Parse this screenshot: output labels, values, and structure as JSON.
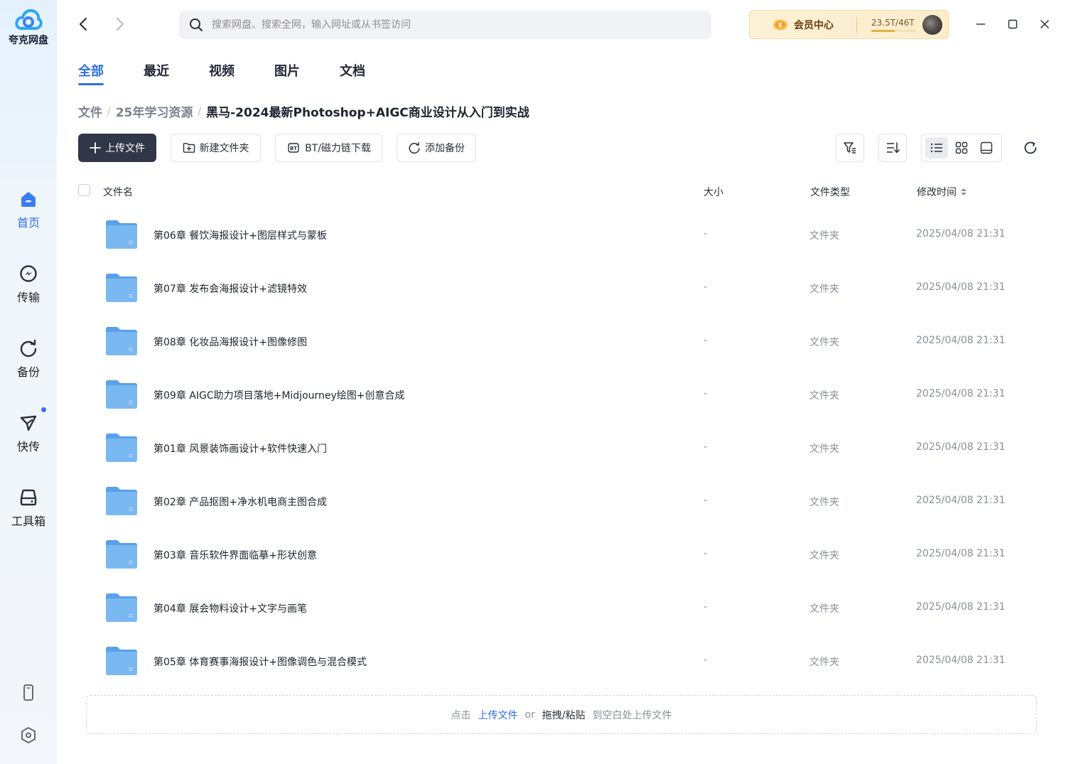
{
  "app": {
    "name": "夸克网盘"
  },
  "sidebar": {
    "items": [
      {
        "label": "首页",
        "icon": "home-icon",
        "active": true
      },
      {
        "label": "传输",
        "icon": "transfer-icon",
        "active": false
      },
      {
        "label": "备份",
        "icon": "backup-icon",
        "active": false
      },
      {
        "label": "快传",
        "icon": "quick-send-icon",
        "active": false,
        "badge_dot": true
      },
      {
        "label": "工具箱",
        "icon": "toolbox-icon",
        "active": false
      }
    ],
    "bottom_icons": [
      "phone-icon",
      "settings-icon"
    ]
  },
  "topbar": {
    "search_placeholder": "搜索网盘、搜索全网，输入网址或从书签访问",
    "vip_label": "会员中心",
    "storage_text": "23.5T/46T",
    "storage_used_fraction": 0.51
  },
  "tabs": [
    {
      "label": "全部",
      "active": true
    },
    {
      "label": "最近",
      "active": false
    },
    {
      "label": "视频",
      "active": false
    },
    {
      "label": "图片",
      "active": false
    },
    {
      "label": "文档",
      "active": false
    }
  ],
  "breadcrumb": {
    "items": [
      "文件",
      "25年学习资源"
    ],
    "current": "黑马-2024最新Photoshop+AIGC商业设计从入门到实战"
  },
  "toolbar": {
    "upload_label": "上传文件",
    "new_folder_label": "新建文件夹",
    "bt_label": "BT/磁力链下载",
    "backup_label": "添加备份"
  },
  "table": {
    "headers": {
      "name": "文件名",
      "size": "大小",
      "type": "文件类型",
      "modified": "修改时间"
    },
    "rows": [
      {
        "name": "第06章 餐饮海报设计+图层样式与蒙板",
        "size": "-",
        "type": "文件夹",
        "modified": "2025/04/08 21:31"
      },
      {
        "name": "第07章 发布会海报设计+滤镜特效",
        "size": "-",
        "type": "文件夹",
        "modified": "2025/04/08 21:31"
      },
      {
        "name": "第08章 化妆品海报设计+图像修图",
        "size": "-",
        "type": "文件夹",
        "modified": "2025/04/08 21:31"
      },
      {
        "name": "第09章 AIGC助力项目落地+Midjourney绘图+创意合成",
        "size": "-",
        "type": "文件夹",
        "modified": "2025/04/08 21:31"
      },
      {
        "name": "第01章 风景装饰画设计+软件快速入门",
        "size": "-",
        "type": "文件夹",
        "modified": "2025/04/08 21:31"
      },
      {
        "name": "第02章 产品抠图+净水机电商主图合成",
        "size": "-",
        "type": "文件夹",
        "modified": "2025/04/08 21:31"
      },
      {
        "name": "第03章 音乐软件界面临摹+形状创意",
        "size": "-",
        "type": "文件夹",
        "modified": "2025/04/08 21:31"
      },
      {
        "name": "第04章 展会物料设计+文字与画笔",
        "size": "-",
        "type": "文件夹",
        "modified": "2025/04/08 21:31"
      },
      {
        "name": "第05章 体育赛事海报设计+图像调色与混合模式",
        "size": "-",
        "type": "文件夹",
        "modified": "2025/04/08 21:31"
      }
    ]
  },
  "dropzone": {
    "prefix": "点击",
    "link": "上传文件",
    "or": "or",
    "strong": "拖拽/粘贴",
    "suffix": "到空白处上传文件"
  },
  "colors": {
    "accent": "#2f6fe4",
    "primary_button": "#313749",
    "vip_gold": "#fbecca",
    "folder_blue": "#6aaef0"
  }
}
